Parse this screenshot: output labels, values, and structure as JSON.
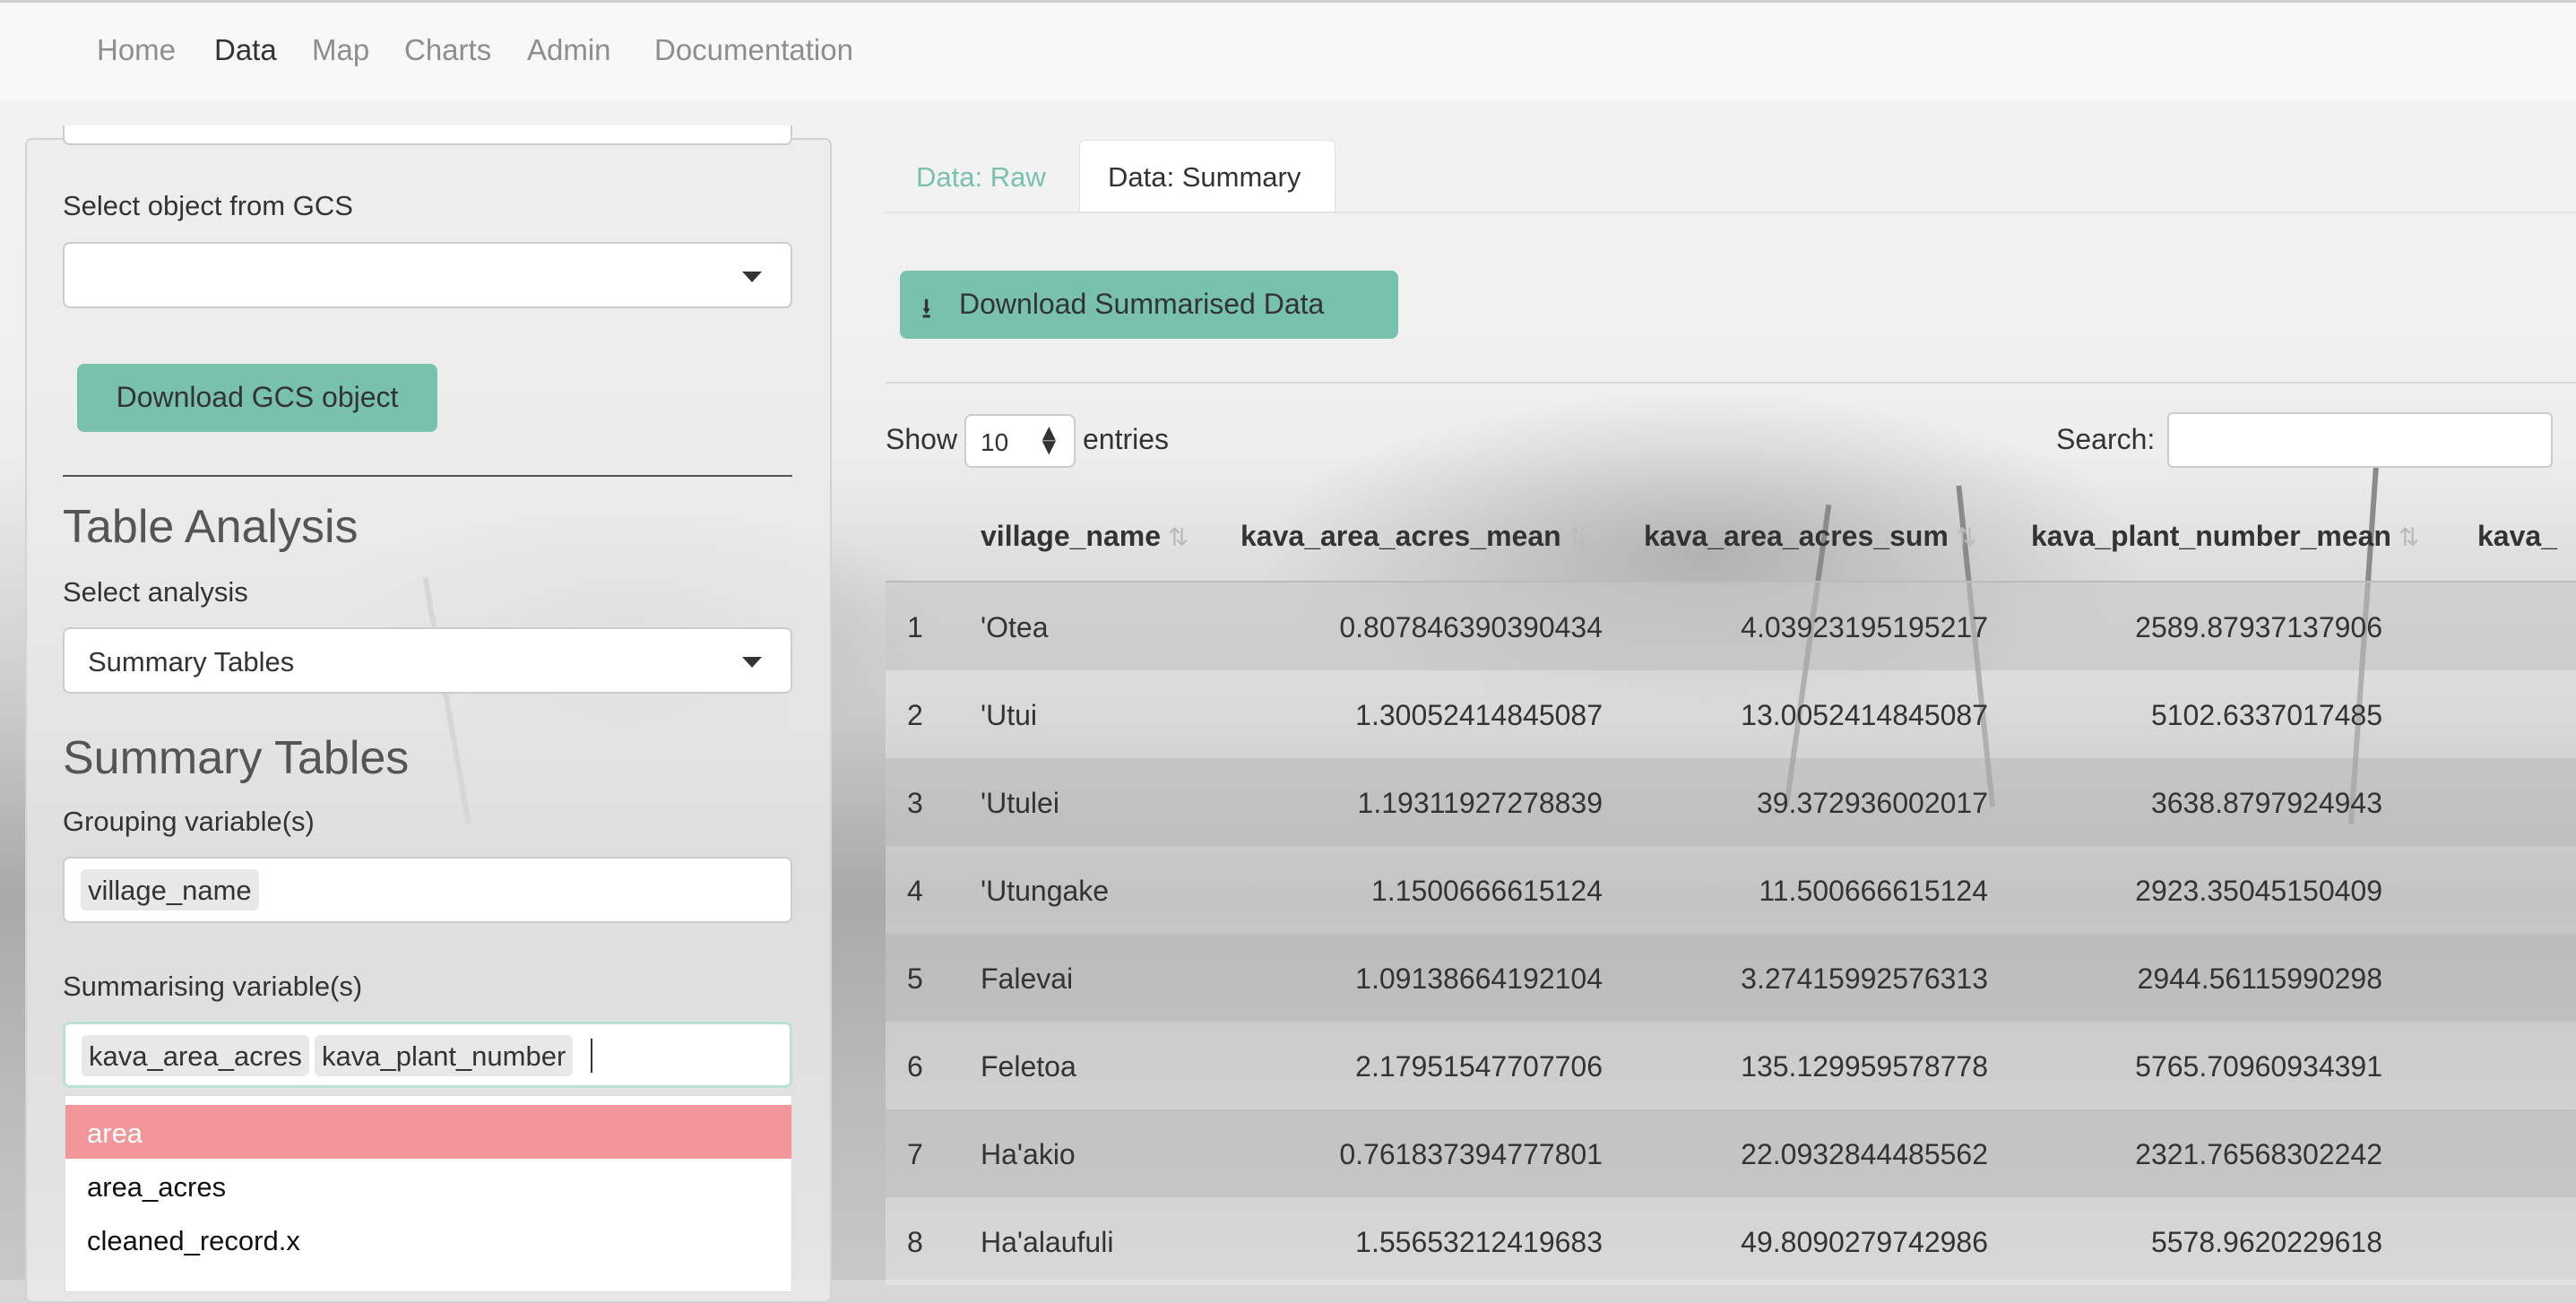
{
  "navbar": {
    "items": [
      "Home",
      "Data",
      "Map",
      "Charts",
      "Admin",
      "Documentation"
    ],
    "active": "Data"
  },
  "sidebar": {
    "gcs_label": "Select object from GCS",
    "gcs_value": "",
    "download_gcs_label": "Download GCS object",
    "table_analysis_heading": "Table Analysis",
    "select_analysis_label": "Select analysis",
    "select_analysis_value": "Summary Tables",
    "summary_tables_heading": "Summary Tables",
    "grouping_label": "Grouping variable(s)",
    "grouping_chips": [
      "village_name"
    ],
    "summarising_label": "Summarising variable(s)",
    "summarising_chips": [
      "kava_area_acres",
      "kava_plant_number"
    ],
    "dropdown_options": [
      "area",
      "area_acres",
      "cleaned_record.x"
    ],
    "dropdown_highlighted": "area"
  },
  "main": {
    "tabs": [
      "Data: Raw",
      "Data: Summary"
    ],
    "active_tab": "Data: Summary",
    "download_summary_label": "Download Summarised Data",
    "show_label": "Show",
    "entries_label": "entries",
    "page_length": "10",
    "search_label": "Search:",
    "search_value": "",
    "columns": [
      "",
      "village_name",
      "kava_area_acres_mean",
      "kava_area_acres_sum",
      "kava_plant_number_mean",
      "kava_"
    ],
    "rows": [
      [
        "1",
        "'Otea",
        "0.807846390390434",
        "4.03923195195217",
        "2589.87937137906"
      ],
      [
        "2",
        "'Utui",
        "1.30052414845087",
        "13.0052414845087",
        "5102.6337017485"
      ],
      [
        "3",
        "'Utulei",
        "1.19311927278839",
        "39.372936002017",
        "3638.8797924943"
      ],
      [
        "4",
        "'Utungake",
        "1.1500666615124",
        "11.500666615124",
        "2923.35045150409"
      ],
      [
        "5",
        "Falevai",
        "1.09138664192104",
        "3.27415992576313",
        "2944.56115990298"
      ],
      [
        "6",
        "Feletoa",
        "2.17951547707706",
        "135.129959578778",
        "5765.70960934391"
      ],
      [
        "7",
        "Ha'akio",
        "0.761837394777801",
        "22.0932844485562",
        "2321.76568302242"
      ],
      [
        "8",
        "Ha'alaufuli",
        "1.55653212419683",
        "49.8090279742986",
        "5578.9620229618"
      ]
    ]
  },
  "colors": {
    "accent_green": "#78c2ad",
    "highlight_pink": "#f3969a"
  }
}
